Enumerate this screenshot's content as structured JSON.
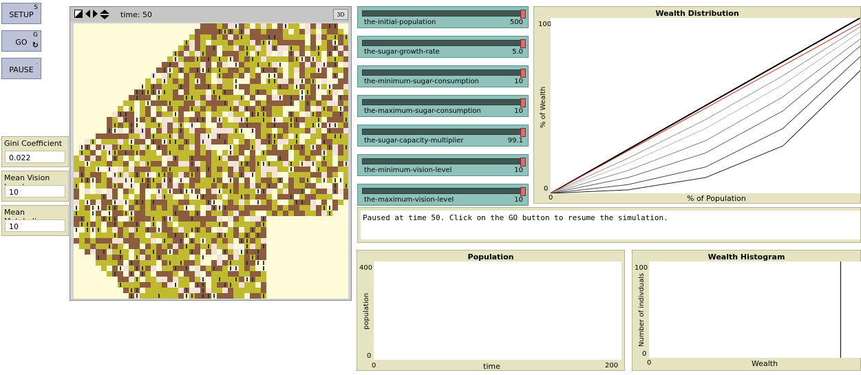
{
  "buttons": {
    "setup": {
      "label": "SETUP",
      "key": "S"
    },
    "go": {
      "label": "GO",
      "key": "G",
      "forever_icon": "↻"
    },
    "pause": {
      "label": "PAUSE",
      "key": "."
    }
  },
  "monitors": [
    {
      "label": "Gini Coefficient",
      "value": "0.022"
    },
    {
      "label": "Mean Vision Level",
      "value": "10"
    },
    {
      "label": "Mean Metabolism",
      "value": "10"
    }
  ],
  "view": {
    "time_label": "time: 50",
    "btn_3d": "3D",
    "colors": {
      "empty": "#fefcd8",
      "brown": "#8c5c3f",
      "olive": "#bfba30",
      "pale": "#f3e2da",
      "agent": "#333333"
    }
  },
  "sliders": [
    {
      "name": "the-initial-population",
      "value": "500",
      "fraction": 1.0
    },
    {
      "name": "the-sugar-growth-rate",
      "value": "5.0",
      "fraction": 1.0
    },
    {
      "name": "the-minimum-sugar-consumption",
      "value": "10",
      "fraction": 1.0
    },
    {
      "name": "the-maximum-sugar-consumption",
      "value": "10",
      "fraction": 1.0
    },
    {
      "name": "the-sugar-capacity-multiplier",
      "value": "99.1",
      "fraction": 1.0
    },
    {
      "name": "the-minimum-vision-level",
      "value": "10",
      "fraction": 1.0
    },
    {
      "name": "the-maximum-vision-level",
      "value": "10",
      "fraction": 1.0
    }
  ],
  "output": {
    "text": "Paused at time 50. Click on the GO button to resume the simulation."
  },
  "plots": {
    "wealth_distribution": {
      "title": "Wealth Distribution",
      "xlabel": "% of Population",
      "ylabel": "% of Wealth",
      "ymax": "100",
      "ymin": "0",
      "xmin": "0"
    },
    "population": {
      "title": "Population",
      "xlabel": "time",
      "ylabel": "population",
      "ymax": "400",
      "ymin": "0",
      "xmin": "0",
      "xmax": "200"
    },
    "wealth_histogram": {
      "title": "Wealth Histogram",
      "xlabel": "Wealth",
      "ylabel": "Number of indivduals",
      "ymax": "100",
      "ymin": "0",
      "xmin": "0"
    }
  },
  "chart_data": [
    {
      "type": "line",
      "title": "Wealth Distribution",
      "xlabel": "% of Population",
      "ylabel": "% of Wealth",
      "xlim": [
        0,
        100
      ],
      "ylim": [
        0,
        100
      ],
      "series": [
        {
          "color": "#000000",
          "x": [
            0,
            100
          ],
          "y": [
            0,
            100
          ]
        },
        {
          "color": "#d03020",
          "x": [
            0,
            100
          ],
          "y": [
            0,
            97
          ]
        },
        {
          "color": "#999999",
          "x": [
            0,
            25,
            50,
            75,
            100
          ],
          "y": [
            0,
            20,
            42,
            67,
            95
          ]
        },
        {
          "color": "#bbbbbb",
          "x": [
            0,
            25,
            50,
            75,
            100
          ],
          "y": [
            0,
            17,
            37,
            62,
            92
          ]
        },
        {
          "color": "#888888",
          "x": [
            0,
            25,
            50,
            75,
            100
          ],
          "y": [
            0,
            13,
            30,
            55,
            88
          ]
        },
        {
          "color": "#666666",
          "x": [
            0,
            25,
            50,
            75,
            100
          ],
          "y": [
            0,
            9,
            23,
            47,
            84
          ]
        },
        {
          "color": "#444444",
          "x": [
            0,
            25,
            50,
            75,
            100
          ],
          "y": [
            0,
            5,
            15,
            37,
            78
          ]
        },
        {
          "color": "#222222",
          "x": [
            0,
            25,
            50,
            75,
            100
          ],
          "y": [
            0,
            2,
            9,
            27,
            70
          ]
        }
      ]
    },
    {
      "type": "line",
      "title": "Population",
      "xlabel": "time",
      "ylabel": "population",
      "xlim": [
        0,
        200
      ],
      "ylim": [
        0,
        400
      ],
      "series": []
    },
    {
      "type": "bar",
      "title": "Wealth Histogram",
      "xlabel": "Wealth",
      "ylabel": "Number of indivduals",
      "ylim": [
        0,
        100
      ],
      "series": []
    }
  ]
}
